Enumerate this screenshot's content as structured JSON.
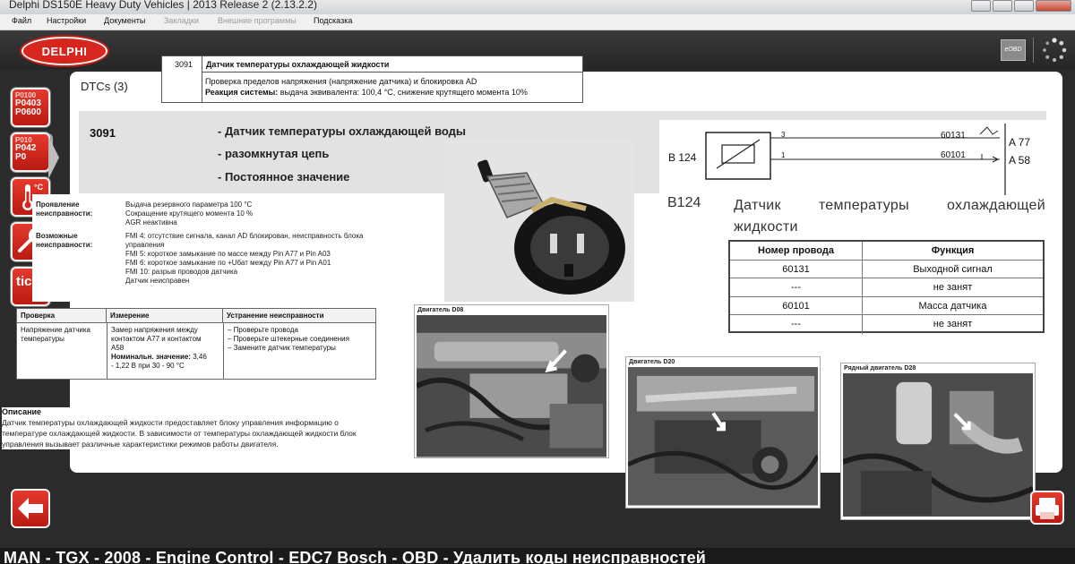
{
  "window": {
    "title": "Delphi DS150E Heavy Duty Vehicles  |  2013 Release 2 (2.13.2.2)"
  },
  "menu": {
    "items": [
      "Файл",
      "Настройки",
      "Документы",
      "Закладки",
      "Внешние программы",
      "Подсказка"
    ],
    "disabled": [
      false,
      false,
      false,
      true,
      true,
      false
    ]
  },
  "brand": {
    "logo_text": "DELPHI",
    "eobd_label": "eOBD",
    "colors": {
      "brand_red": "#d7261e",
      "panel": "#ffffff",
      "band": "#e2e2e2"
    }
  },
  "sidebar": {
    "button1_codes": [
      "P0100",
      "P0403",
      "P0600"
    ],
    "button2_codes": [
      "P010",
      "P042",
      "P0"
    ],
    "button3_label": "°C",
    "button5_label": "tic",
    "icons": [
      "dtc-list-icon",
      "dtc-clear-icon",
      "live-data-icon",
      "actuator-test-icon",
      "ticket-icon",
      "back-arrow-icon",
      "print-icon",
      "loading-spinner-icon"
    ]
  },
  "dtcs_label": "DTCs (3)",
  "tooltip": {
    "code": "3091",
    "header": "Датчик температуры охлаждающей жидкости",
    "line2": "Проверка пределов напряжения (напряжение датчика) и блокировка AD",
    "reaction_label": "Реакция системы:",
    "reaction_text": " выдача эквивалента: 100,4 °C, снижение крутящего момента 10%"
  },
  "dtc": {
    "code": "3091",
    "lines": [
      "- Датчик температуры охлаждающей воды",
      "- разомкнутая цепь",
      "- Постоянное значение"
    ]
  },
  "info": {
    "manifestation_label": [
      "Проявление",
      "неисправности:"
    ],
    "manifestation_text": [
      "Выдача резервного параметра 100 °C",
      "Сокращение крутящего момента 10 %",
      "AGR неактивна"
    ],
    "possible_label": [
      "Возможные",
      "неисправности:"
    ],
    "possible_text": [
      "FMI 4: отсутствие сигнала, канал AD блокирован, неисправность блока",
      "управления",
      "FMI 5: короткое замыкание по массе между Pin A77 и Pin A03",
      "FMI 6: короткое замыкание по +Uбат между Pin A77 и Pin A01",
      "FMI 10: разрыв проводов датчика",
      "Датчик неисправен"
    ]
  },
  "check_table": {
    "headers": [
      "Проверка",
      "Измерение",
      "Устранение неисправности"
    ],
    "check": [
      "Напряжение датчика",
      "температуры"
    ],
    "measure": [
      "Замер напряжения между",
      "контактом A77 и контактом",
      "A58"
    ],
    "nominal_label": "Номинальн. значение:",
    "nominal_value": " 3,46",
    "nominal_rest": "- 1,22 В при 30 - 90 °C",
    "fix": [
      "–  Проверьте провода",
      "–  Проверьте штекерные соединения",
      "–  Замените датчик температуры"
    ]
  },
  "description": {
    "heading": "Описание",
    "text": [
      "Датчик температуры охлаждающей жидкости предоставляет блоку управления информацию о",
      "температуре охлаждающей жидкости. В зависимости от температуры охлаждающей жидкости блок",
      "управления вызывает различные характеристики режимов работы двигателя."
    ]
  },
  "schematic": {
    "component": "B 124",
    "pin_top": "3",
    "pin_bottom": "1",
    "wire_top": "60131",
    "wire_bottom": "60101",
    "conn_top": "A 77",
    "conn_bottom": "A 58"
  },
  "component_title": {
    "id": "B124",
    "name": "Датчик температуры охлаждающей жидкости"
  },
  "wire_table": {
    "headers": [
      "Номер провода",
      "Функция"
    ],
    "rows": [
      [
        "60131",
        "Выходной сигнал"
      ],
      [
        "---",
        "не занят"
      ],
      [
        "60101",
        "Масса датчика"
      ],
      [
        "---",
        "не занят"
      ]
    ]
  },
  "photos": {
    "d08": "Двигатель D08",
    "d20": "Двигатель D20",
    "d28": "Рядный двигатель D28"
  },
  "footer": {
    "text": "MAN - TGX - 2008 - Engine Control - EDC7 Bosch - OBD - Удалить коды неисправностей"
  }
}
